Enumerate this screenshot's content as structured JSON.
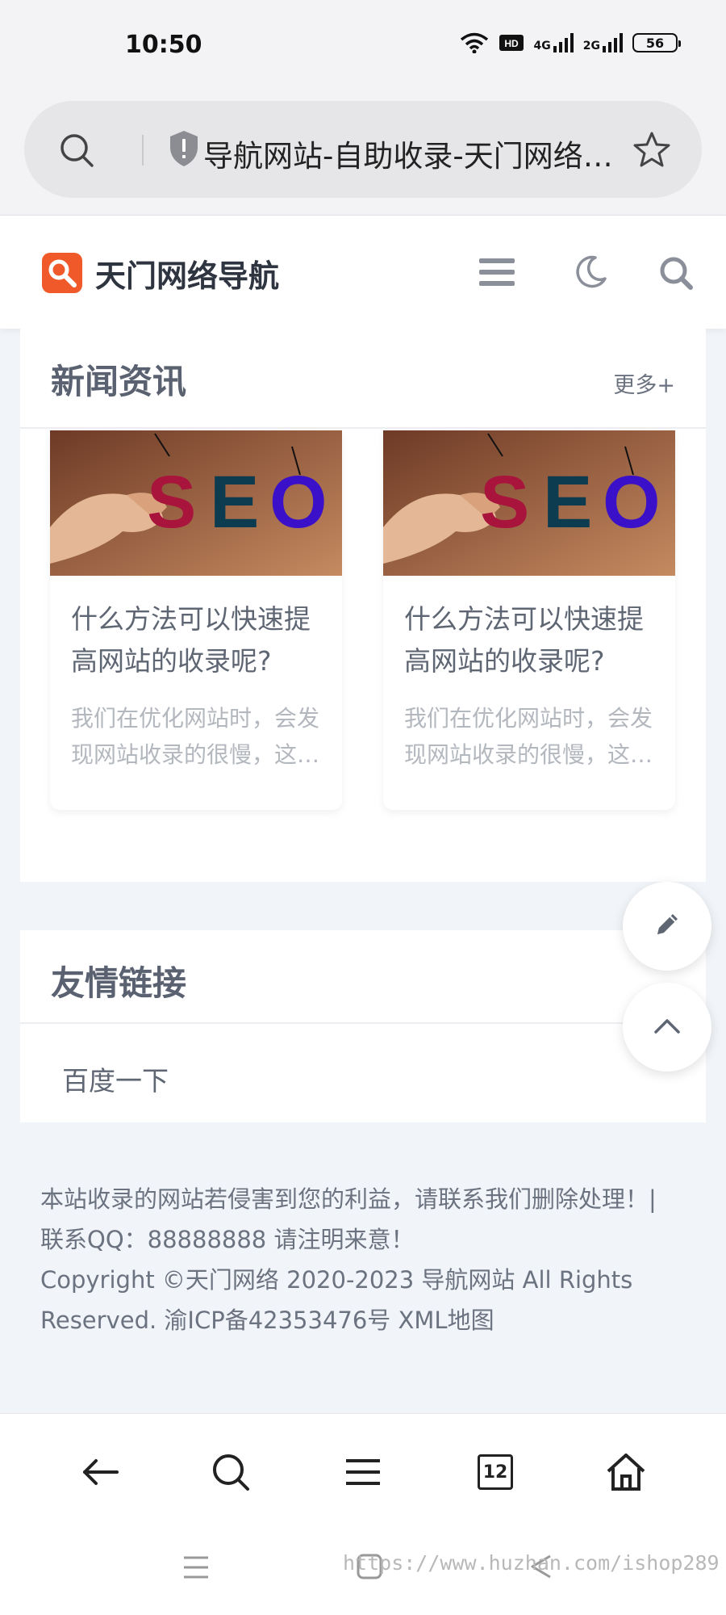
{
  "status_bar": {
    "time": "10:50",
    "network_1": "4G",
    "network_2": "2G",
    "battery": "56",
    "icons": [
      "wifi-icon",
      "hd-icon",
      "signal-icon",
      "signal-icon",
      "battery-icon"
    ]
  },
  "browser": {
    "address_title": "导航网站-自助收录-天门网络导航",
    "icons": [
      "search-icon",
      "shield-icon",
      "star-icon"
    ]
  },
  "header": {
    "site_name": "天门网络导航",
    "logo_color": "#f05a2a",
    "icons": [
      "menu-icon",
      "moon-icon",
      "search-icon"
    ]
  },
  "news": {
    "title": "新闻资讯",
    "more": "更多+",
    "articles": [
      {
        "title": "什么方法可以快速提高网站的收录呢?",
        "excerpt": "我们在优化网站时，会发现网站收录的很慢，这是为什么呢？"
      },
      {
        "title": "什么方法可以快速提高网站的收录呢?",
        "excerpt": "我们在优化网站时，会发现网站收录的很慢，这是为什么呢？"
      }
    ]
  },
  "links": {
    "title": "友情链接",
    "items": [
      "百度一下"
    ]
  },
  "floating": {
    "icons": [
      "pencil-icon",
      "chevron-up-icon"
    ]
  },
  "footer": {
    "line1": "本站收录的网站若侵害到您的利益，请联系我们删除处理！|",
    "line2": "联系QQ：88888888 请注明来意！",
    "line3": "Copyright ©天门网络 2020-2023 导航网站 All Rights Reserved. 渝ICP备42353476号 XML地图"
  },
  "bottom_nav": {
    "tab_count": "12",
    "icons": [
      "back-arrow-icon",
      "search-icon",
      "menu-icon",
      "tabs-icon",
      "home-icon"
    ]
  },
  "watermark": "https://www.huzhan.com/ishop289"
}
